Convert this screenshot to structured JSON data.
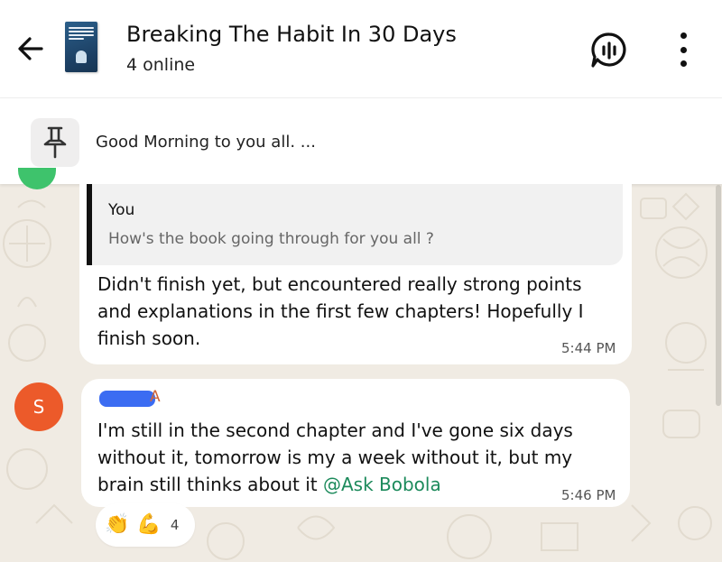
{
  "header": {
    "title": "Breaking The Habit In 30 Days",
    "subtitle": "4 online",
    "back_icon": "arrow-left-icon",
    "voice_chat_icon": "voice-chat-icon",
    "menu_icon": "more-vertical-icon"
  },
  "pinned": {
    "icon": "pin-icon",
    "text": "Good Morning to you all. ..."
  },
  "messages": [
    {
      "quote": {
        "author": "You",
        "text": "How's the book going through for you all ?"
      },
      "text": "Didn't finish yet, but encountered really strong points and explanations in the first few chapters! Hopefully I finish soon.",
      "time": "5:44 PM"
    },
    {
      "avatar_letter": "S",
      "sender_visible": "A",
      "text_before_mention": "I'm still in the second chapter and I've gone six days without it, tomorrow is my a week without it, but my brain still thinks about it ",
      "mention": "@Ask Bobola",
      "time": "5:46 PM",
      "reactions": {
        "emojis": [
          "👏",
          "💪"
        ],
        "count": "4"
      }
    }
  ],
  "colors": {
    "header_bg": "#ffffff",
    "wallpaper": "#f0ebe3",
    "bubble": "#ffffff",
    "avatar_s": "#ec5a2a",
    "mention": "#1c8a5b",
    "sender_name": "#d2673a",
    "redaction": "#3b6cf2"
  }
}
